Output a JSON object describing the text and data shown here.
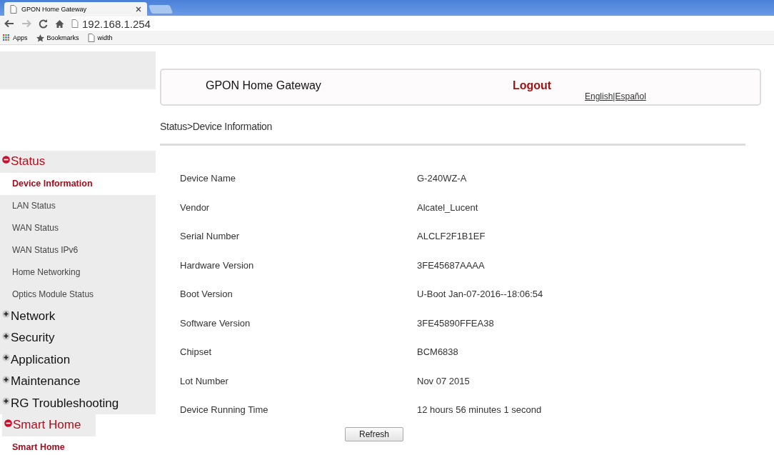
{
  "browser": {
    "tab_title": "GPON Home Gateway",
    "address": "192.168.1.254",
    "bookmarks": [
      {
        "label": "Apps",
        "kind": "apps"
      },
      {
        "label": "Bookmarks",
        "kind": "star"
      },
      {
        "label": "width",
        "kind": "page"
      }
    ]
  },
  "header": {
    "title": "GPON Home Gateway",
    "logout": "Logout",
    "languages": [
      "English",
      "|Español"
    ]
  },
  "breadcrumb": "Status>Device Information",
  "menu": [
    {
      "label": "Status",
      "expanded": true,
      "children": [
        {
          "label": "Device Information",
          "selected": true
        },
        {
          "label": "LAN Status",
          "selected": false
        },
        {
          "label": "WAN Status",
          "selected": false
        },
        {
          "label": "WAN Status IPv6",
          "selected": false
        },
        {
          "label": "Home Networking",
          "selected": false
        },
        {
          "label": "Optics Module Status",
          "selected": false
        }
      ]
    },
    {
      "label": "Network",
      "expanded": false
    },
    {
      "label": "Security",
      "expanded": false
    },
    {
      "label": "Application",
      "expanded": false
    },
    {
      "label": "Maintenance",
      "expanded": false
    },
    {
      "label": "RG Troubleshooting",
      "expanded": false
    },
    {
      "label": "Smart Home",
      "expanded": true,
      "children": [
        {
          "label": "Smart Home",
          "selected": true
        }
      ]
    }
  ],
  "info": [
    {
      "label": "Device Name",
      "value": "G-240WZ-A"
    },
    {
      "label": "Vendor",
      "value": "Alcatel_Lucent"
    },
    {
      "label": "Serial Number",
      "value": "ALCLF2F1B1EF"
    },
    {
      "label": "Hardware Version",
      "value": "3FE45687AAAA"
    },
    {
      "label": "Boot Version",
      "value": "U-Boot Jan-07-2016--18:06:54"
    },
    {
      "label": "Software Version",
      "value": "3FE45890FFEA38"
    },
    {
      "label": "Chipset",
      "value": "BCM6838"
    },
    {
      "label": "Lot Number",
      "value": "Nov 07 2015"
    },
    {
      "label": "Device Running Time",
      "value": "12 hours 56 minutes 1 second"
    }
  ],
  "refresh_button": "Refresh"
}
